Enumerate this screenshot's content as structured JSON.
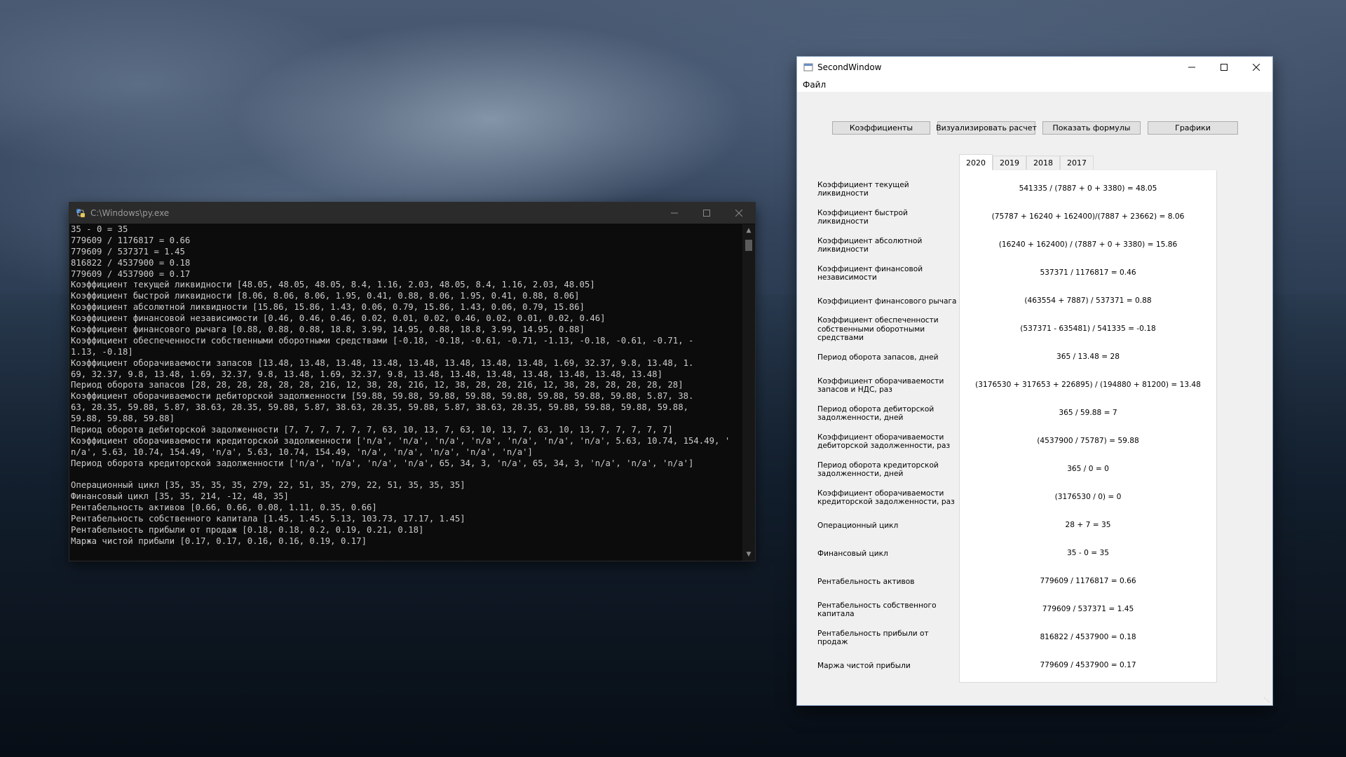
{
  "console": {
    "title": "C:\\Windows\\py.exe",
    "lines": [
      "35 - 0 = 35",
      "779609 / 1176817 = 0.66",
      "779609 / 537371 = 1.45",
      "816822 / 4537900 = 0.18",
      "779609 / 4537900 = 0.17",
      "Коэффициент текущей ликвидности [48.05, 48.05, 48.05, 8.4, 1.16, 2.03, 48.05, 8.4, 1.16, 2.03, 48.05]",
      "Коэффициент быстрой ликвидности [8.06, 8.06, 8.06, 1.95, 0.41, 0.88, 8.06, 1.95, 0.41, 0.88, 8.06]",
      "Коэффициент абсолютной ликвидности [15.86, 15.86, 1.43, 0.06, 0.79, 15.86, 1.43, 0.06, 0.79, 15.86]",
      "Коэффициент финансовой независимости [0.46, 0.46, 0.46, 0.02, 0.01, 0.02, 0.46, 0.02, 0.01, 0.02, 0.46]",
      "Коэффициент финансового рычага [0.88, 0.88, 0.88, 18.8, 3.99, 14.95, 0.88, 18.8, 3.99, 14.95, 0.88]",
      "Коэффициент обеспеченности собственными оборотными средствами [-0.18, -0.18, -0.61, -0.71, -1.13, -0.18, -0.61, -0.71, -",
      "1.13, -0.18]",
      "Коэффициент оборачиваемости запасов [13.48, 13.48, 13.48, 13.48, 13.48, 13.48, 13.48, 13.48, 1.69, 32.37, 9.8, 13.48, 1.",
      "69, 32.37, 9.8, 13.48, 1.69, 32.37, 9.8, 13.48, 1.69, 32.37, 9.8, 13.48, 13.48, 13.48, 13.48, 13.48, 13.48, 13.48]",
      "Период оборота запасов [28, 28, 28, 28, 28, 28, 216, 12, 38, 28, 216, 12, 38, 28, 28, 216, 12, 38, 28, 28, 28, 28, 28]",
      "Коэффициент оборачиваемости дебиторской задолженности [59.88, 59.88, 59.88, 59.88, 59.88, 59.88, 59.88, 59.88, 5.87, 38.",
      "63, 28.35, 59.88, 5.87, 38.63, 28.35, 59.88, 5.87, 38.63, 28.35, 59.88, 5.87, 38.63, 28.35, 59.88, 59.88, 59.88, 59.88,",
      "59.88, 59.88, 59.88]",
      "Период оборота дебиторской задолженности [7, 7, 7, 7, 7, 7, 63, 10, 13, 7, 63, 10, 13, 7, 63, 10, 13, 7, 7, 7, 7, 7]",
      "Коэффициент оборачиваемости кредиторской задолженности ['n/a', 'n/a', 'n/a', 'n/a', 'n/a', 'n/a', 'n/a', 5.63, 10.74, 154.49, '",
      "n/a', 5.63, 10.74, 154.49, 'n/a', 5.63, 10.74, 154.49, 'n/a', 'n/a', 'n/a', 'n/a', 'n/a']",
      "Период оборота кредиторской задолженности ['n/a', 'n/a', 'n/a', 'n/a', 65, 34, 3, 'n/a', 65, 34, 3, 'n/a', 'n/a', 'n/a']",
      "",
      "Операционный цикл [35, 35, 35, 35, 279, 22, 51, 35, 279, 22, 51, 35, 35, 35]",
      "Финансовый цикл [35, 35, 214, -12, 48, 35]",
      "Рентабельность активов [0.66, 0.66, 0.08, 1.11, 0.35, 0.66]",
      "Рентабельность собственного капитала [1.45, 1.45, 5.13, 103.73, 17.17, 1.45]",
      "Рентабельность прибыли от продаж [0.18, 0.18, 0.2, 0.19, 0.21, 0.18]",
      "Маржа чистой прибыли [0.17, 0.17, 0.16, 0.16, 0.19, 0.17]"
    ]
  },
  "window": {
    "title": "SecondWindow",
    "menu": {
      "file": "Файл"
    },
    "buttons": {
      "coefficients": "Коэффициенты",
      "visualize": "Визуализировать расчет",
      "formulas": "Показать формулы",
      "charts": "Графики"
    },
    "tabs": [
      "2020",
      "2019",
      "2018",
      "2017"
    ],
    "active_tab": "2020",
    "rows": [
      {
        "label": "Коэффициент текущей ликвидности",
        "value": "541335 / (7887 + 0 + 3380) = 48.05"
      },
      {
        "label": "Коэффициент быстрой ликвидности",
        "value": "(75787 + 16240 + 162400)/(7887 + 23662) = 8.06"
      },
      {
        "label": "Коэффициент абсолютной ликвидности",
        "value": "(16240 + 162400) / (7887 + 0 + 3380) = 15.86"
      },
      {
        "label": "Коэффициент финансовой независимости",
        "value": "537371 / 1176817 = 0.46"
      },
      {
        "label": "Коэффициент финансового рычага",
        "value": "(463554 + 7887) / 537371 = 0.88"
      },
      {
        "label": "Коэффициент обеспеченности собственными оборотными средствами",
        "value": "(537371 - 635481) / 541335 = -0.18"
      },
      {
        "label": "Период оборота запасов, дней",
        "value": "365 / 13.48 = 28"
      },
      {
        "label": "Коэффициент оборачиваемости запасов и НДС, раз",
        "value": "(3176530 + 317653 + 226895) / (194880 + 81200) = 13.48"
      },
      {
        "label": "Период оборота дебиторской задолженности, дней",
        "value": "365 / 59.88 = 7"
      },
      {
        "label": "Коэффициент оборачиваемости дебиторской задолженности, раз",
        "value": "(4537900 / 75787) = 59.88"
      },
      {
        "label": "Период оборота кредиторской задолженности, дней",
        "value": "365 / 0 = 0"
      },
      {
        "label": "Коэффициент оборачиваемости кредиторской задолженности, раз",
        "value": "(3176530 / 0) = 0"
      },
      {
        "label": "Операционный цикл",
        "value": "28 + 7 = 35"
      },
      {
        "label": "Финансовый цикл",
        "value": "35 - 0 = 35"
      },
      {
        "label": "Рентабельность активов",
        "value": "779609 / 1176817 = 0.66"
      },
      {
        "label": "Рентабельность собственного капитала",
        "value": "779609 / 537371 = 1.45"
      },
      {
        "label": "Рентабельность прибыли от продаж",
        "value": "816822 / 4537900 = 0.18"
      },
      {
        "label": "Маржа чистой прибыли",
        "value": "779609 / 4537900 = 0.17"
      }
    ]
  }
}
